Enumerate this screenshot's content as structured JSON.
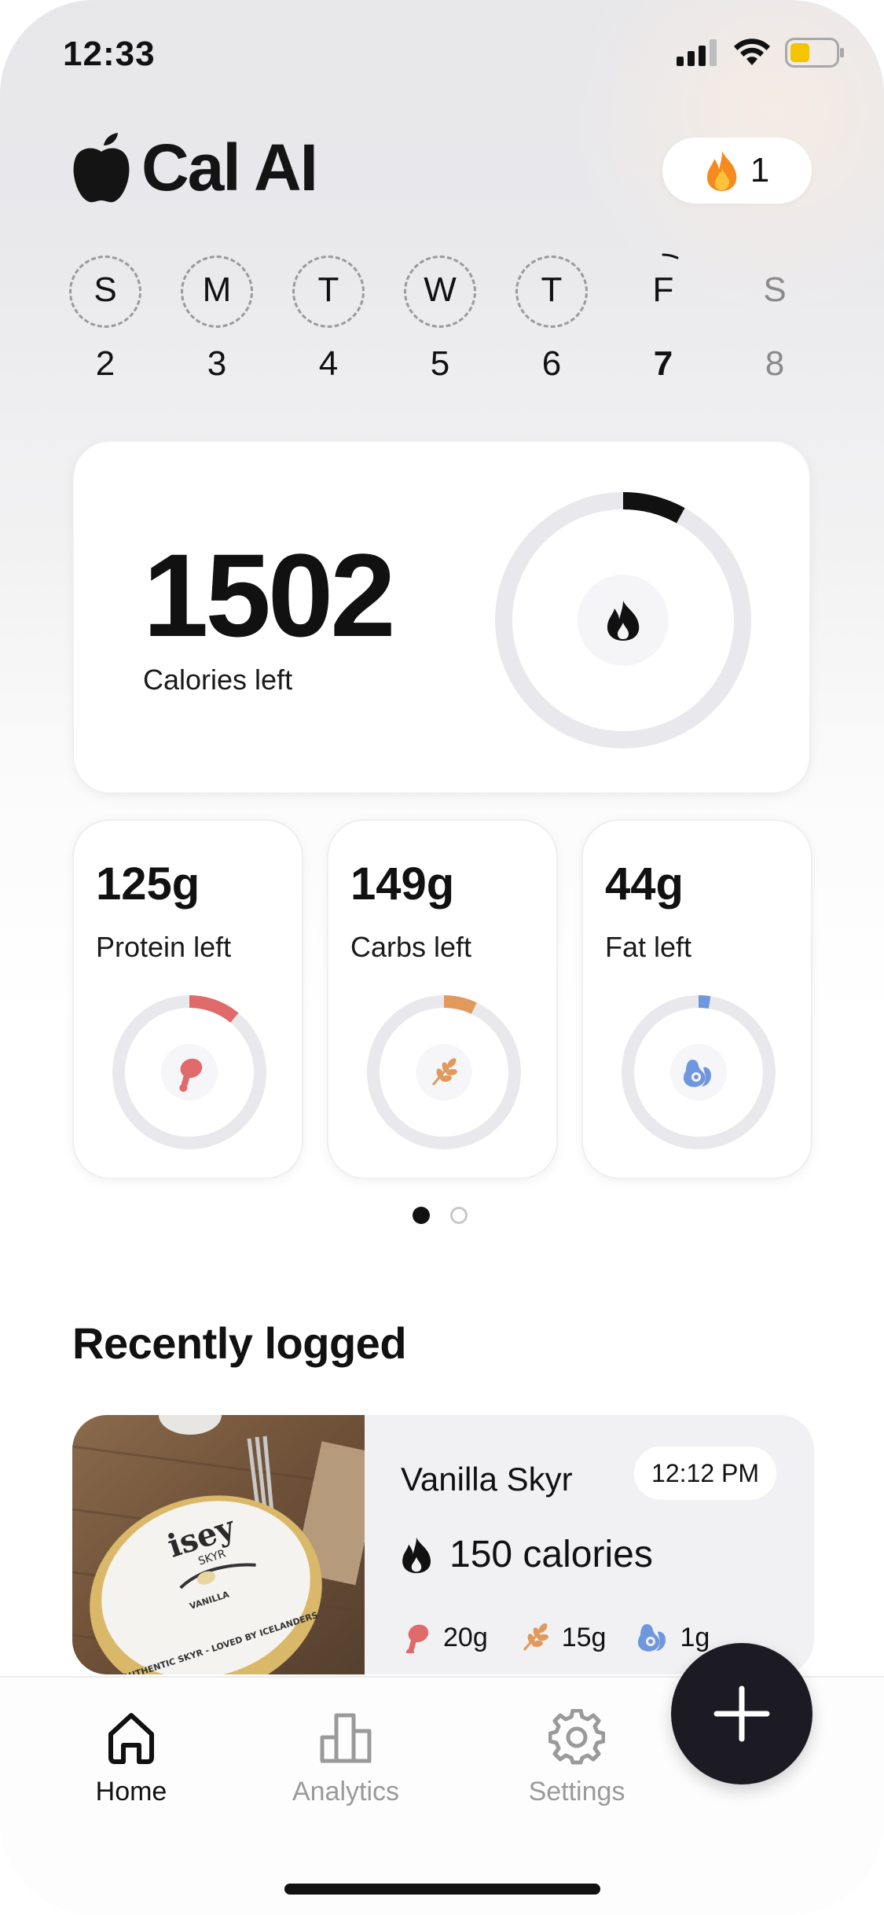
{
  "status_bar": {
    "time": "12:33",
    "battery_color": "#f5c400"
  },
  "header": {
    "app_title": "Cal AI",
    "logo_icon": "apple-icon",
    "streak_icon": "flame-icon",
    "streak_count": "1"
  },
  "week": {
    "days": [
      {
        "letter": "S",
        "number": "2",
        "state": "past"
      },
      {
        "letter": "M",
        "number": "3",
        "state": "past"
      },
      {
        "letter": "T",
        "number": "4",
        "state": "past"
      },
      {
        "letter": "W",
        "number": "5",
        "state": "past"
      },
      {
        "letter": "T",
        "number": "6",
        "state": "past"
      },
      {
        "letter": "F",
        "number": "7",
        "state": "today"
      },
      {
        "letter": "S",
        "number": "8",
        "state": "future"
      }
    ]
  },
  "calories": {
    "value": "1502",
    "label": "Calories left",
    "progress": 0.08,
    "ring_color": "#111111",
    "icon": "flame-icon"
  },
  "macros": [
    {
      "value": "125g",
      "label": "Protein left",
      "progress": 0.11,
      "color": "#e06a6a",
      "icon": "drumstick-icon"
    },
    {
      "value": "149g",
      "label": "Carbs left",
      "progress": 0.07,
      "color": "#e09a5c",
      "icon": "wheat-icon"
    },
    {
      "value": "44g",
      "label": "Fat left",
      "progress": 0.025,
      "color": "#6f97dd",
      "icon": "avocado-icon"
    }
  ],
  "pager": {
    "pages": 2,
    "active": 0
  },
  "recent": {
    "title": "Recently logged",
    "items": [
      {
        "name": "Vanilla Skyr",
        "time": "12:12 PM",
        "calories": "150 calories",
        "protein": "20g",
        "carbs": "15g",
        "fat": "1g",
        "photo_brand": "isey",
        "photo_sub": "SKYR",
        "photo_flavor": "VANILLA",
        "photo_tagline": "AUTHENTIC SKYR - LOVED BY ICELANDERS"
      }
    ]
  },
  "tabs": [
    {
      "label": "Home",
      "icon": "home-icon",
      "active": true
    },
    {
      "label": "Analytics",
      "icon": "bar-chart-icon",
      "active": false
    },
    {
      "label": "Settings",
      "icon": "gear-icon",
      "active": false
    }
  ],
  "fab": {
    "icon": "plus-icon"
  }
}
